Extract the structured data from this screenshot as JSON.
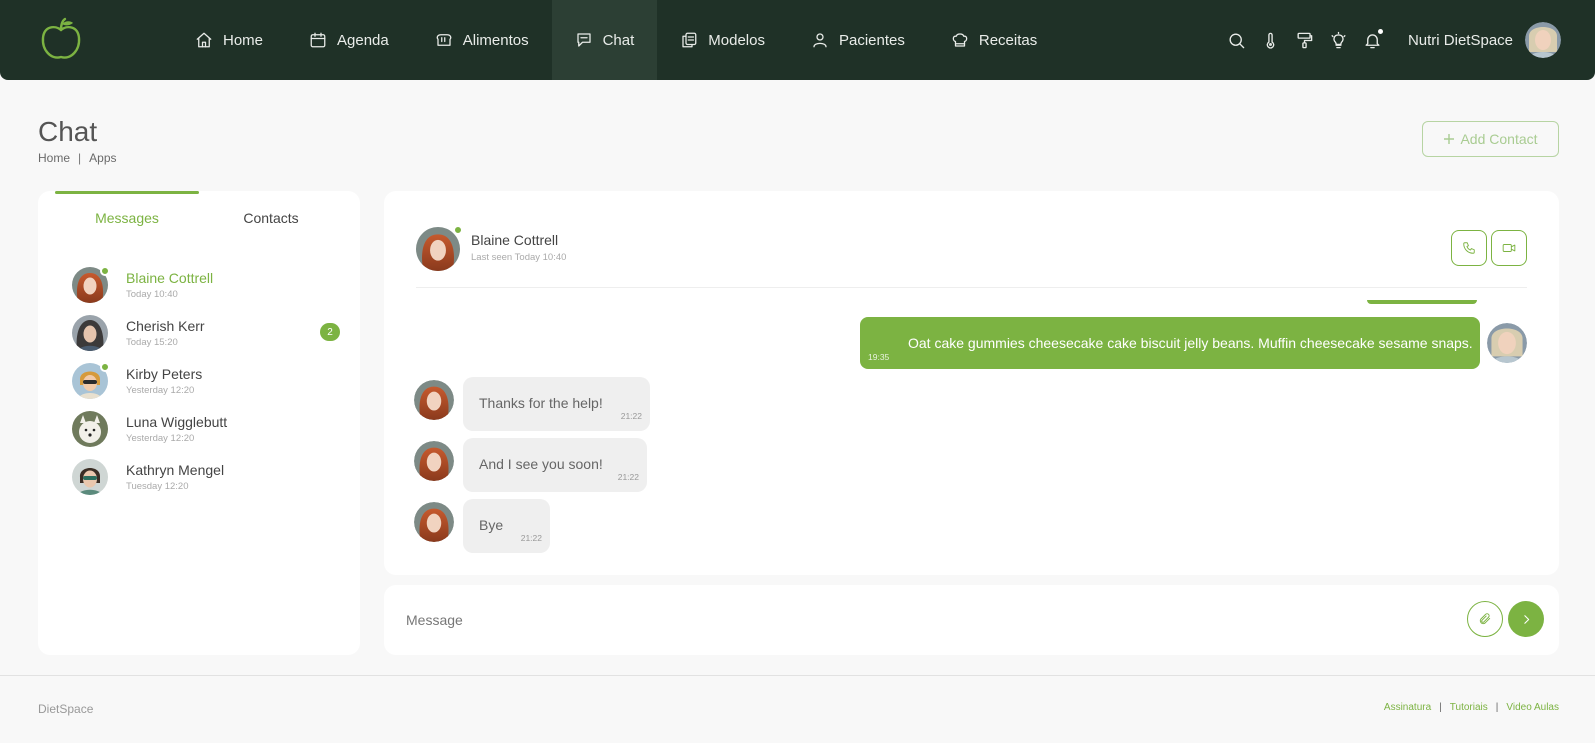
{
  "colors": {
    "nav_bg": "#1f3127",
    "accent": "#7cb342",
    "page_bg": "#f8f8f8"
  },
  "navbar": {
    "items": [
      {
        "label": "Home",
        "icon": "home-icon"
      },
      {
        "label": "Agenda",
        "icon": "calendar-icon"
      },
      {
        "label": "Alimentos",
        "icon": "bread-icon"
      },
      {
        "label": "Chat",
        "icon": "chat-icon",
        "active": true
      },
      {
        "label": "Modelos",
        "icon": "copy-icon"
      },
      {
        "label": "Pacientes",
        "icon": "user-icon"
      },
      {
        "label": "Receitas",
        "icon": "chef-hat-icon"
      }
    ],
    "user_name": "Nutri DietSpace"
  },
  "page": {
    "title": "Chat",
    "breadcrumb": [
      "Home",
      "|",
      "Apps"
    ],
    "add_contact_label": "Add Contact"
  },
  "sidebar": {
    "tabs": [
      "Messages",
      "Contacts"
    ],
    "contacts": [
      {
        "name": "Blaine Cottrell",
        "time": "Today 10:40",
        "online": true,
        "active": true,
        "unread": ""
      },
      {
        "name": "Cherish Kerr",
        "time": "Today 15:20",
        "online": false,
        "unread": "2"
      },
      {
        "name": "Kirby Peters",
        "time": "Yesterday 12:20",
        "online": true,
        "unread": ""
      },
      {
        "name": "Luna Wigglebutt",
        "time": "Yesterday 12:20",
        "online": false,
        "unread": ""
      },
      {
        "name": "Kathryn Mengel",
        "time": "Tuesday 12:20",
        "online": false,
        "unread": ""
      }
    ]
  },
  "chat": {
    "contact_name": "Blaine Cottrell",
    "last_seen": "Last seen Today 10:40",
    "messages": [
      {
        "direction": "out",
        "text": "Oat cake gummies cheesecake cake biscuit jelly beans. Muffin cheesecake sesame snaps.",
        "time": "19:35"
      },
      {
        "direction": "in",
        "text": "Thanks for the help!",
        "time": "21:22"
      },
      {
        "direction": "in",
        "text": "And I see you soon!",
        "time": "21:22"
      },
      {
        "direction": "in",
        "text": "Bye",
        "time": "21:22"
      }
    ],
    "input_placeholder": "Message"
  },
  "footer": {
    "brand": "DietSpace",
    "links": [
      "Assinatura",
      "Tutoriais",
      "Video Aulas"
    ],
    "separator": "|"
  }
}
